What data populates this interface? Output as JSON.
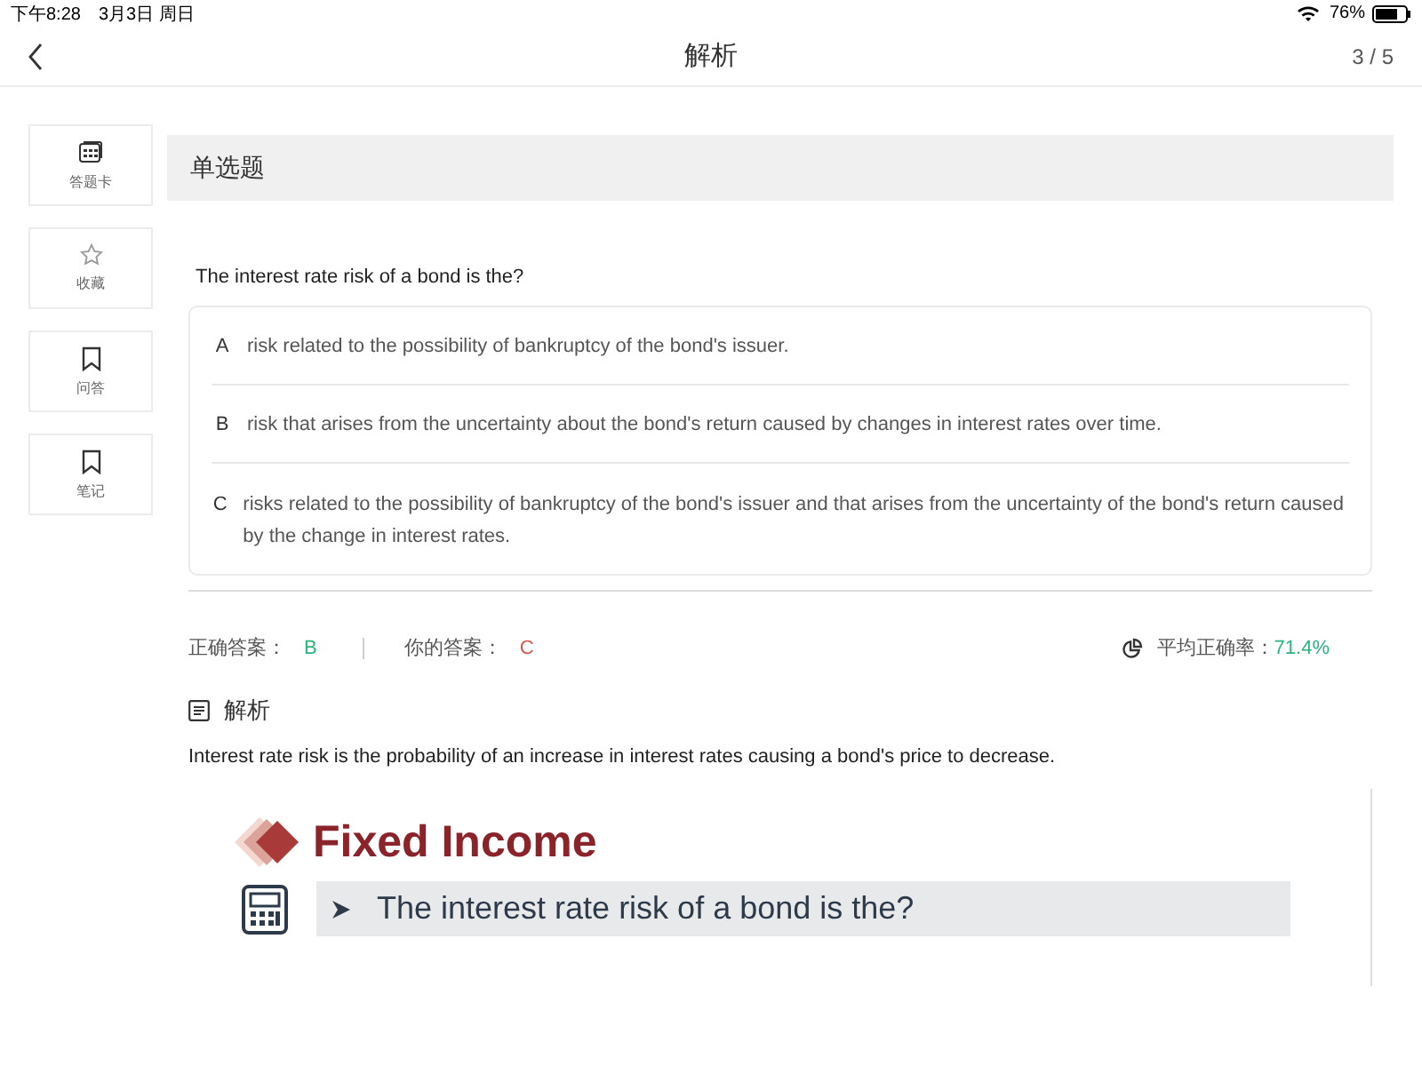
{
  "status_bar": {
    "time": "下午8:28",
    "date": "3月3日 周日",
    "battery": "76%"
  },
  "nav": {
    "title": "解析",
    "progress": "3 / 5"
  },
  "sidebar": [
    {
      "kind": "card",
      "label": "答题卡"
    },
    {
      "kind": "star",
      "label": "收藏"
    },
    {
      "kind": "bookmark",
      "label": "问答"
    },
    {
      "kind": "bookmark",
      "label": "笔记"
    }
  ],
  "question_type": "单选题",
  "question": "The interest rate risk of a bond is the?",
  "options": [
    {
      "letter": "A",
      "text": "risk related to the possibility of bankruptcy of the bond's issuer."
    },
    {
      "letter": "B",
      "text": "risk that arises from the uncertainty about the bond's return caused by changes in interest rates over time."
    },
    {
      "letter": "C",
      "text": "risks related to the possibility of bankruptcy of the bond's issuer and that arises from the uncertainty of the bond's return caused by the change in interest rates."
    }
  ],
  "answers": {
    "correct_label": "正确答案：",
    "correct": "B",
    "yours_label": "你的答案：",
    "yours": "C",
    "rate_label": "平均正确率：",
    "rate": "71.4%"
  },
  "analysis": {
    "heading": "解析",
    "text": "Interest rate risk is the probability of an increase in interest rates causing a bond's price to decrease."
  },
  "slide": {
    "title": "Fixed Income",
    "bullet": "The interest rate risk of a bond is the?"
  }
}
